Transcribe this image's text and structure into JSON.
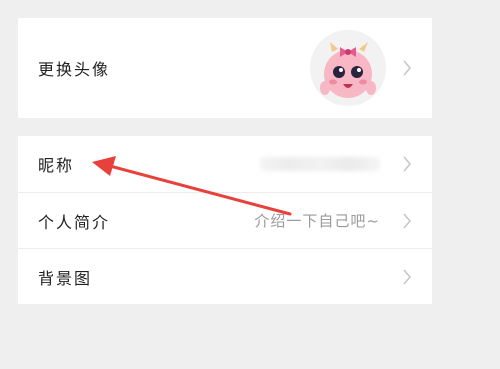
{
  "profile": {
    "change_avatar_label": "更换头像",
    "nickname_label": "昵称",
    "bio_label": "个人简介",
    "bio_placeholder": "介绍一下自己吧~",
    "background_label": "背景图"
  },
  "colors": {
    "page_bg": "#efefef",
    "card_bg": "#ffffff",
    "annotation_arrow": "#e8403a"
  },
  "icons": {
    "row_chevron": "chevron-right-icon",
    "avatar_image": "cartoon-pink-monster-avatar"
  }
}
